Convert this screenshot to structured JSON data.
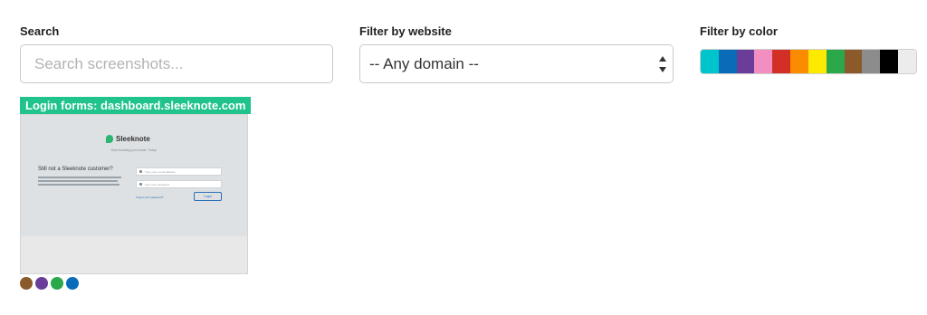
{
  "filters": {
    "search": {
      "label": "Search",
      "placeholder": "Search screenshots...",
      "value": ""
    },
    "website": {
      "label": "Filter by website",
      "selected": "-- Any domain --"
    },
    "color": {
      "label": "Filter by color",
      "swatches": [
        {
          "name": "cyan",
          "hex": "#00c4cc"
        },
        {
          "name": "blue",
          "hex": "#0a6cb8"
        },
        {
          "name": "purple",
          "hex": "#6a3d9a"
        },
        {
          "name": "pink",
          "hex": "#f28fc0"
        },
        {
          "name": "red",
          "hex": "#d22f27"
        },
        {
          "name": "orange",
          "hex": "#fb8c00"
        },
        {
          "name": "yellow",
          "hex": "#fdea00"
        },
        {
          "name": "green",
          "hex": "#2ba84a"
        },
        {
          "name": "brown",
          "hex": "#8a5a2b"
        },
        {
          "name": "gray",
          "hex": "#8c8c8c"
        },
        {
          "name": "black",
          "hex": "#000000"
        },
        {
          "name": "white",
          "hex": "#ececec"
        }
      ]
    }
  },
  "card": {
    "title": "Login forms: dashboard.sleeknote.com",
    "title_bg": "#1fc38b",
    "thumbnail": {
      "logo": "Sleeknote",
      "tagline": "Start boosting your leads. Today.",
      "heading": "Still not a Sleeknote customer?",
      "email_placeholder": "Type your e-mail address",
      "password_placeholder": "Type your password",
      "forgot": "Forgot your password?",
      "button": "Login"
    },
    "colors": [
      {
        "name": "brown",
        "hex": "#8a5a2b"
      },
      {
        "name": "purple",
        "hex": "#6a3d9a"
      },
      {
        "name": "green",
        "hex": "#2ba84a"
      },
      {
        "name": "blue",
        "hex": "#0a6cb8"
      }
    ]
  }
}
